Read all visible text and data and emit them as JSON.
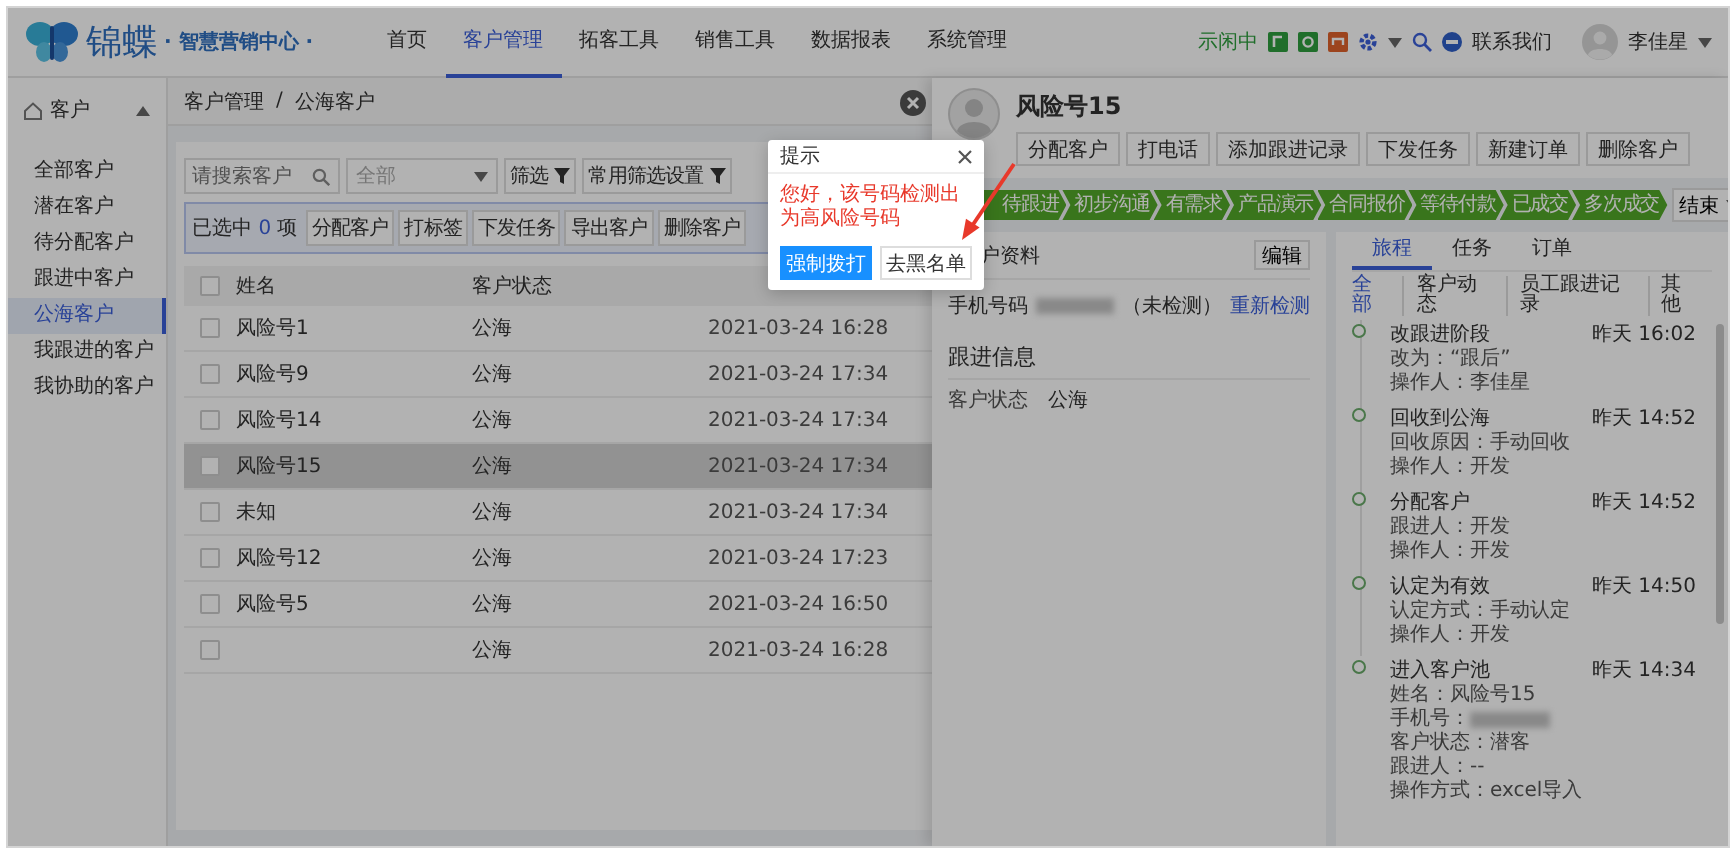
{
  "header": {
    "logo": {
      "name": "锦蝶",
      "subtitle": "· 智慧营销中心 ·"
    },
    "nav": [
      {
        "label": "首页",
        "selected": false
      },
      {
        "label": "客户管理",
        "selected": true
      },
      {
        "label": "拓客工具",
        "selected": false
      },
      {
        "label": "销售工具",
        "selected": false
      },
      {
        "label": "数据报表",
        "selected": false
      },
      {
        "label": "系统管理",
        "selected": false
      }
    ],
    "status": "示闲中",
    "contact": "联系我们",
    "user": "李佳星"
  },
  "sidebar": {
    "group": {
      "label": "客户",
      "expanded": true
    },
    "items": [
      {
        "label": "全部客户",
        "selected": false
      },
      {
        "label": "潜在客户",
        "selected": false
      },
      {
        "label": "待分配客户",
        "selected": false
      },
      {
        "label": "跟进中客户",
        "selected": false
      },
      {
        "label": "公海客户",
        "selected": true
      },
      {
        "label": "我跟进的客户",
        "selected": false
      },
      {
        "label": "我协助的客户",
        "selected": false
      }
    ]
  },
  "breadcrumb": {
    "items": [
      "客户管理",
      "公海客户"
    ],
    "separator": "/"
  },
  "filters": {
    "search": {
      "placeholder": "请搜索客户"
    },
    "dropdown": "全部",
    "buttons": [
      "筛选",
      "常用筛选设置"
    ]
  },
  "selection": {
    "prefix": "已选中",
    "count": "0",
    "suffix": "项",
    "actions": [
      "分配客户",
      "打标签",
      "下发任务",
      "导出客户",
      "删除客户"
    ]
  },
  "table": {
    "all_checked": false,
    "columns": [
      "姓名",
      "客户状态"
    ],
    "rows": [
      {
        "name": "风险号1",
        "status": "公海",
        "time": "2021-03-24 16:28",
        "checked": false,
        "highlighted": false
      },
      {
        "name": "风险号9",
        "status": "公海",
        "time": "2021-03-24 17:34",
        "checked": false,
        "highlighted": false
      },
      {
        "name": "风险号14",
        "status": "公海",
        "time": "2021-03-24 17:34",
        "checked": false,
        "highlighted": false
      },
      {
        "name": "风险号15",
        "status": "公海",
        "time": "2021-03-24 17:34",
        "checked": false,
        "highlighted": true
      },
      {
        "name": "未知",
        "status": "公海",
        "time": "2021-03-24 17:34",
        "checked": false,
        "highlighted": false
      },
      {
        "name": "风险号12",
        "status": "公海",
        "time": "2021-03-24 17:23",
        "checked": false,
        "highlighted": false
      },
      {
        "name": "风险号5",
        "status": "公海",
        "time": "2021-03-24 16:50",
        "checked": false,
        "highlighted": false
      },
      {
        "status": "公海",
        "time": "2021-03-24 16:28",
        "checked": false,
        "highlighted": false
      }
    ]
  },
  "drawer": {
    "name": "风险号15",
    "actions": [
      "分配客户",
      "打电话",
      "添加跟进记录",
      "下发任务",
      "新建订单",
      "删除客户"
    ],
    "stages": [
      {
        "label": "待跟进",
        "done": true
      },
      {
        "label": "初步沟通",
        "done": true
      },
      {
        "label": "有需求",
        "done": true
      },
      {
        "label": "产品演示",
        "done": true
      },
      {
        "label": "合同报价",
        "done": true
      },
      {
        "label": "等待付款",
        "done": true
      },
      {
        "label": "已成交",
        "done": true
      },
      {
        "label": "多次成交",
        "done": true
      }
    ],
    "end_button": "结束",
    "profile": {
      "title": "户资料",
      "edit": "编辑",
      "phone_label": "手机号码",
      "phone_note": "（未检测）",
      "recheck": "重新检测",
      "section": "跟进信息",
      "fields": [
        {
          "label": "客户状态",
          "value": "公海"
        }
      ]
    },
    "tabs": [
      {
        "label": "旅程",
        "selected": true
      },
      {
        "label": "任务",
        "selected": false
      },
      {
        "label": "订单",
        "selected": false
      }
    ],
    "filters": [
      {
        "label": "全部",
        "selected": true
      },
      {
        "label": "客户动态",
        "selected": false
      },
      {
        "label": "员工跟进记录",
        "selected": false
      },
      {
        "label": "其他",
        "selected": false
      }
    ],
    "timeline": [
      {
        "title": "改跟进阶段",
        "time": "昨天 16:02",
        "lines": [
          {
            "kind": "text",
            "text": "改为：“跟后”"
          },
          {
            "kind": "text",
            "text": "操作人：李佳星"
          }
        ]
      },
      {
        "title": "回收到公海",
        "time": "昨天 14:52",
        "lines": [
          {
            "kind": "text",
            "text": "回收原因：手动回收"
          },
          {
            "kind": "text",
            "text": "操作人：开发"
          }
        ]
      },
      {
        "title": "分配客户",
        "time": "昨天 14:52",
        "lines": [
          {
            "kind": "text",
            "text": "跟进人：开发"
          },
          {
            "kind": "text",
            "text": "操作人：开发"
          }
        ]
      },
      {
        "title": "认定为有效",
        "time": "昨天 14:50",
        "lines": [
          {
            "kind": "text",
            "text": "认定方式：手动认定"
          },
          {
            "kind": "text",
            "text": "操作人：开发"
          }
        ]
      },
      {
        "title": "进入客户池",
        "time": "昨天 14:34",
        "lines": [
          {
            "kind": "text",
            "text": "姓名：风险号15"
          },
          {
            "kind": "masked",
            "text": "手机号："
          },
          {
            "kind": "text",
            "text": "客户状态：潜客"
          },
          {
            "kind": "text",
            "text": "跟进人：--"
          },
          {
            "kind": "text",
            "text": "操作方式：excel导入"
          }
        ]
      }
    ]
  },
  "dialog": {
    "title": "提示",
    "message": "您好，该号码检测出为高风险号码",
    "buttons": [
      {
        "label": "强制拨打",
        "kind": "primary"
      },
      {
        "label": "去黑名单",
        "kind": "default"
      }
    ]
  }
}
